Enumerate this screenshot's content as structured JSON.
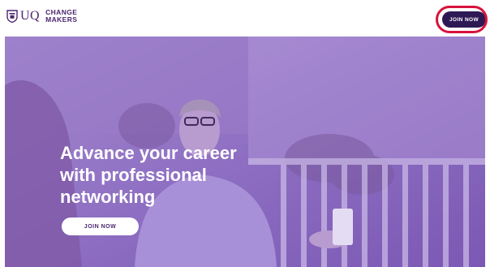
{
  "header": {
    "logo_uq": "UQ",
    "brand_line1": "CHANGE",
    "brand_line2": "MAKERS",
    "join_label": "JOIN NOW"
  },
  "hero": {
    "headline_line1": "Advance your career",
    "headline_line2": "with professional",
    "headline_line3": "networking",
    "join_label": "JOIN NOW"
  },
  "colors": {
    "brand_purple": "#4a2670",
    "button_dark": "#2d1a54",
    "highlight_ring": "#d8123c",
    "hero_overlay": "#8a5fc4"
  },
  "icons": {
    "crest": "uq-crest-icon"
  }
}
